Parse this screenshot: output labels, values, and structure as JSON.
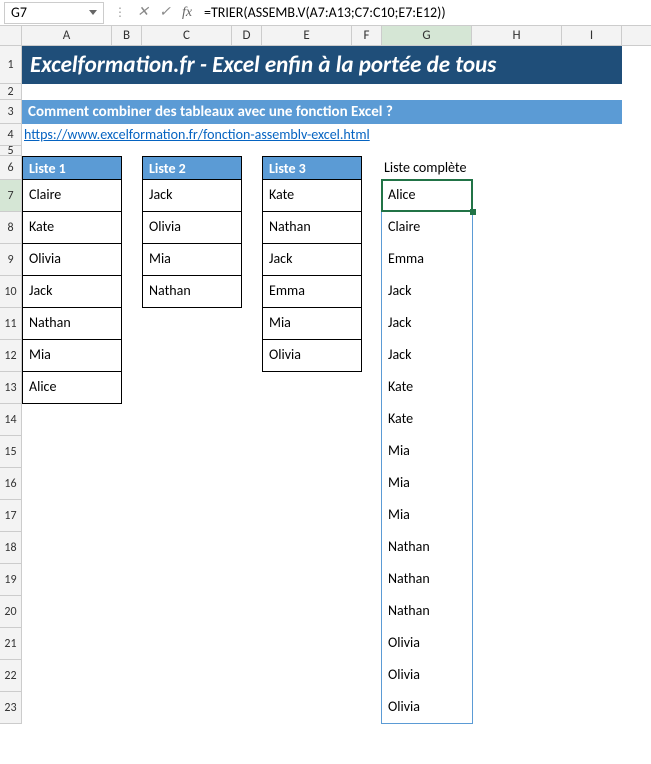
{
  "nameBox": "G7",
  "formula": "=TRIER(ASSEMB.V(A7:A13;C7:C10;E7:E12))",
  "columns": [
    "A",
    "B",
    "C",
    "D",
    "E",
    "F",
    "G",
    "H",
    "I"
  ],
  "selectedCol": "G",
  "rowCount": 23,
  "selectedRow": 7,
  "title": "Excelformation.fr - Excel enfin à la portée de tous",
  "subtitle": "Comment combiner des tableaux avec une fonction Excel ?",
  "link": "https://www.excelformation.fr/fonction-assemblv-excel.html",
  "list1": {
    "header": "Liste 1",
    "items": [
      "Claire",
      "Kate",
      "Olivia",
      "Jack",
      "Nathan",
      "Mia",
      "Alice"
    ]
  },
  "list2": {
    "header": "Liste 2",
    "items": [
      "Jack",
      "Olivia",
      "Mia",
      "Nathan"
    ]
  },
  "list3": {
    "header": "Liste 3",
    "items": [
      "Kate",
      "Nathan",
      "Jack",
      "Emma",
      "Mia",
      "Olivia"
    ]
  },
  "resultHeader": "Liste complète",
  "result": [
    "Alice",
    "Claire",
    "Emma",
    "Jack",
    "Jack",
    "Jack",
    "Kate",
    "Kate",
    "Mia",
    "Mia",
    "Mia",
    "Nathan",
    "Nathan",
    "Nathan",
    "Olivia",
    "Olivia",
    "Olivia"
  ]
}
